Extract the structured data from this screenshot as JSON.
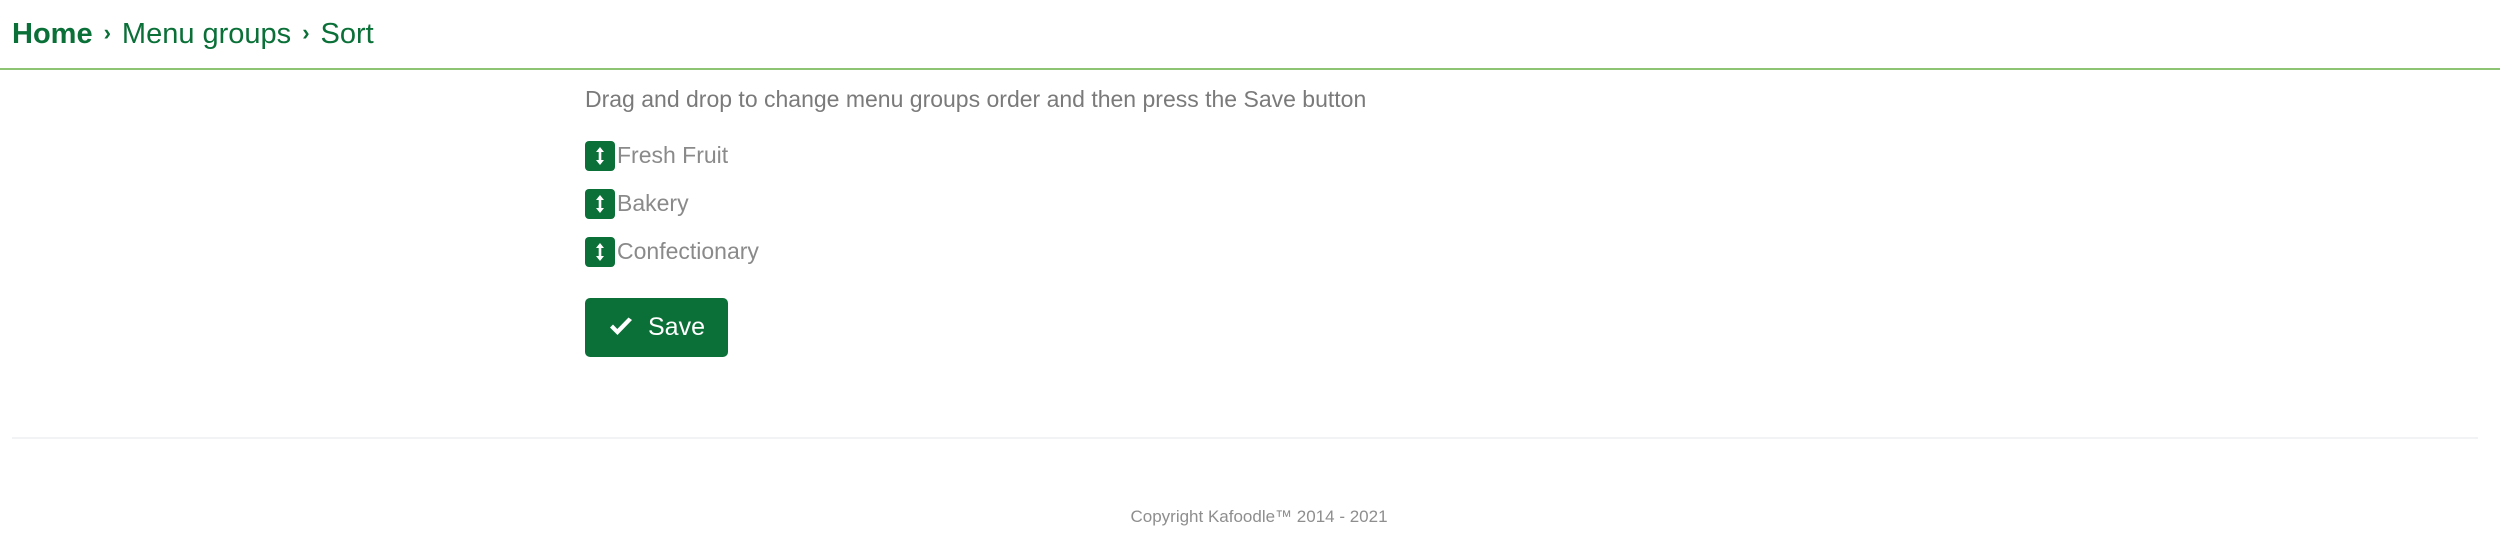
{
  "breadcrumb": {
    "separator": "›",
    "items": [
      {
        "label": "Home",
        "bold": true
      },
      {
        "label": "Menu groups",
        "bold": false
      },
      {
        "label": "Sort",
        "bold": false
      }
    ]
  },
  "main": {
    "instructions": "Drag and drop to change menu groups order and then press the Save button",
    "sort_items": [
      {
        "label": "Fresh Fruit",
        "handle_icon": "drag-vertical-arrows-icon"
      },
      {
        "label": "Bakery",
        "handle_icon": "drag-vertical-arrows-icon"
      },
      {
        "label": "Confectionary",
        "handle_icon": "drag-vertical-arrows-icon"
      }
    ],
    "save_button": {
      "label": "Save",
      "icon": "check-icon"
    }
  },
  "footer": {
    "copyright": "Copyright Kafoodle™ 2014 - 2021"
  },
  "colors": {
    "brand_green": "#0a7038",
    "divider_green": "#8dc474",
    "muted_text": "#8a8a8a",
    "instruction_text": "#7a7a7a",
    "footer_text": "#8e8e8e",
    "footer_rule": "#f2f3f4",
    "button_text": "#ffffff"
  }
}
